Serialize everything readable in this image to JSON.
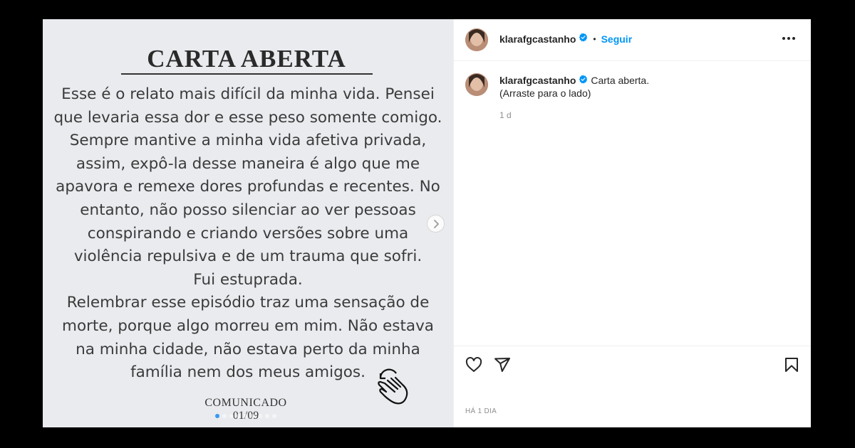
{
  "letter": {
    "title": "CARTA ABERTA",
    "lines": [
      "Esse é o relato mais difícil da minha vida. Pensei",
      "que levaria essa dor e esse peso somente comigo.",
      "Sempre mantive a minha vida afetiva privada,",
      "assim, expô-la desse maneira é algo que me",
      "apavora e remexe dores profundas e recentes. No",
      "entanto, não posso silenciar ao ver pessoas",
      "conspirando e criando versões sobre uma",
      "violência repulsiva e de um trauma que sofri.",
      "Fui estuprada.",
      "Relembrar esse episódio traz uma sensação de",
      "morte, porque algo morreu em mim. Não estava",
      "na minha cidade, não estava perto da minha",
      "família nem dos meus amigos."
    ],
    "footer_label": "COMUNICADO",
    "page_indicator": "01/09"
  },
  "carousel": {
    "slide_count": 9,
    "active_index": 0,
    "next_icon": "chevron-right-icon"
  },
  "post": {
    "username": "klarafgcastanho",
    "verified": true,
    "bullet": "•",
    "follow_label": "Seguir",
    "caption": "Carta aberta.",
    "caption_line2": "(Arraste para o lado)",
    "time_ago": "1 d",
    "date_label": "HÁ 1 DIA"
  },
  "icons": {
    "more": "more-options-icon",
    "like": "heart-icon",
    "share": "send-icon",
    "save": "bookmark-icon",
    "verified": "verified-badge-icon",
    "hand": "swipe-hand-icon"
  },
  "colors": {
    "accent": "#0095f6",
    "text": "#262626",
    "muted": "#8e8e8e",
    "image_bg": "#e9ebee"
  }
}
